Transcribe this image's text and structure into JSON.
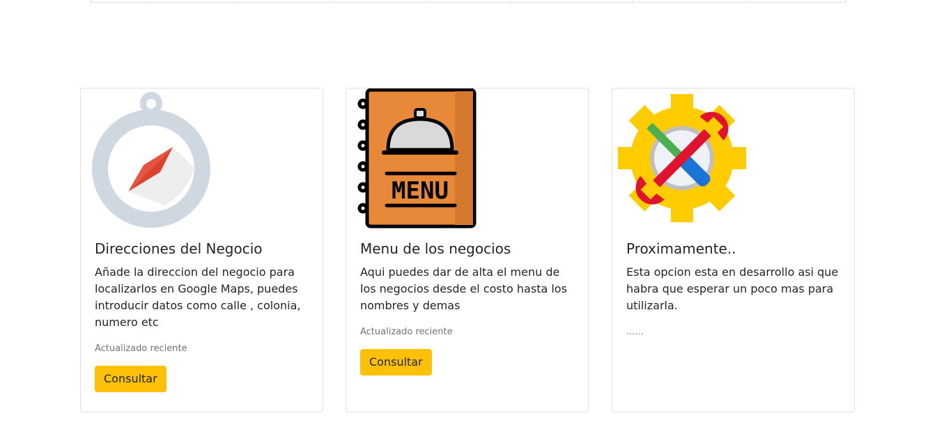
{
  "cards": [
    {
      "title": "Direcciones del Negocio",
      "text": "Añade la direccion del negocio para localizarlos en Google Maps, puedes introducir datos como calle , colonia, numero etc",
      "muted": "Actualizado reciente",
      "button": "Consultar",
      "icon": "compass-icon"
    },
    {
      "title": "Menu de los negocios",
      "text": "Aqui puedes dar de alta el menu de los negocios desde el costo hasta los nombres y demas",
      "muted": "Actualizado reciente",
      "button": "Consultar",
      "icon": "menu-book-icon",
      "icon_label": "MENU"
    },
    {
      "title": "Proximamente..",
      "text": "Esta opcion esta en desarrollo asi que habra que esperar un poco mas para utilizarla.",
      "muted": "......",
      "icon": "tools-gear-icon"
    }
  ],
  "colors": {
    "button": "#ffc107",
    "muted": "#6c757d",
    "compass_ring": "#cfd8e0",
    "compass_needle": "#d9432f",
    "menu_cover": "#e8893a",
    "gear": "#ffcc00",
    "wrench": "#e0132e",
    "screwdriver": "#1a73d9"
  }
}
